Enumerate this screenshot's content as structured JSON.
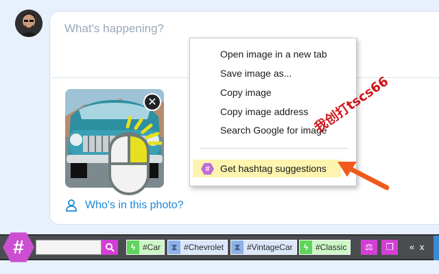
{
  "compose": {
    "placeholder": "What's happening?",
    "who_in_photo": "Who's in this photo?"
  },
  "context_menu": {
    "items": [
      "Open image in a new tab",
      "Save image as...",
      "Copy image",
      "Copy image address",
      "Search Google for image"
    ],
    "hashtag_item": "Get hashtag suggestions"
  },
  "watermark": "我创打tscs66",
  "hashtag_bar": {
    "logo": "#",
    "search_value": "",
    "tags": [
      {
        "label": "#Car",
        "kind": "trending"
      },
      {
        "label": "#Chevrolet",
        "kind": "timed"
      },
      {
        "label": "#VintageCar",
        "kind": "timed"
      },
      {
        "label": "#Classic",
        "kind": "trending"
      }
    ],
    "collapse_label": "«",
    "close_label": "x"
  },
  "colors": {
    "accent": "#d33fd6",
    "link": "#1b87d6",
    "highlight": "#fdf4b0",
    "arrow": "#f05a1a"
  },
  "icons": {
    "close": "close-icon",
    "person": "person-icon",
    "search": "search-icon",
    "scale": "scale-icon",
    "copy": "copy-icon"
  }
}
